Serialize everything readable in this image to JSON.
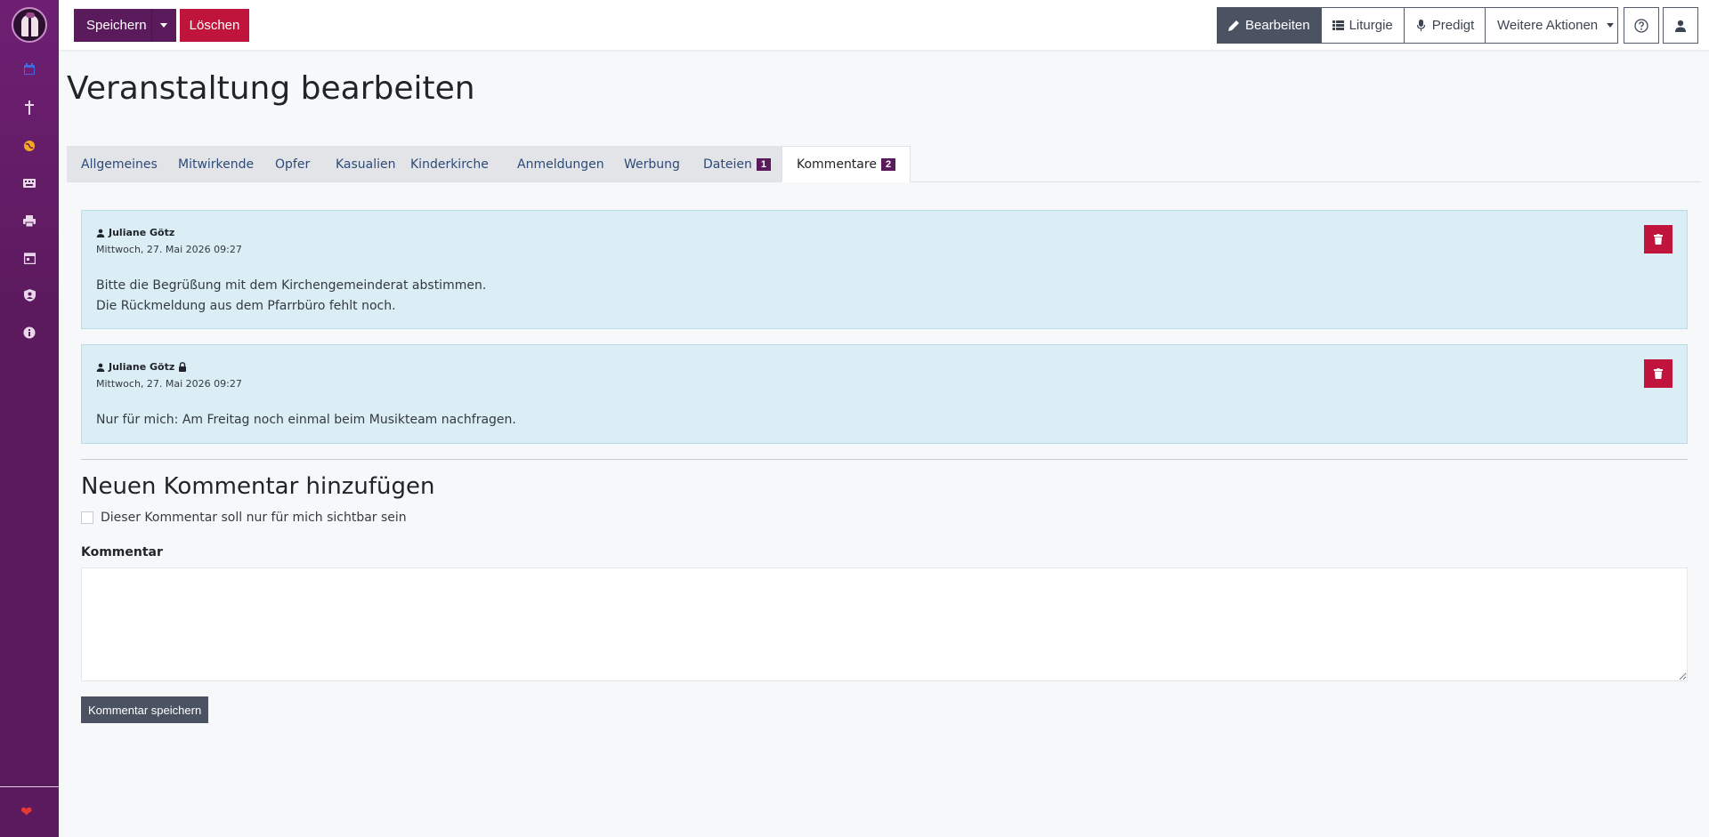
{
  "toolbar": {
    "save_label": "Speichern",
    "delete_label": "Löschen",
    "edit_label": "Bearbeiten",
    "liturgy_label": "Liturgie",
    "sermon_label": "Predigt",
    "more_label": "Weitere Aktionen"
  },
  "page": {
    "title": "Veranstaltung bearbeiten"
  },
  "tabs": [
    {
      "label": "Allgemeines"
    },
    {
      "label": "Mitwirkende"
    },
    {
      "label": "Opfer"
    },
    {
      "label": "Kasualien"
    },
    {
      "label": "Kinderkirche"
    },
    {
      "label": "Anmeldungen"
    },
    {
      "label": "Werbung"
    },
    {
      "label": "Dateien",
      "badge": "1"
    },
    {
      "label": "Kommentare",
      "badge": "2"
    }
  ],
  "comments": [
    {
      "author": "Juliane Götz",
      "date": "Mittwoch, 27. Mai 2026 09:27",
      "lines": [
        "Bitte die Begrüßung mit dem Kirchengemeinderat abstimmen.",
        "Die Rückmeldung aus dem Pfarrbüro fehlt noch."
      ]
    },
    {
      "author": "Juliane Götz",
      "date": "Mittwoch, 27. Mai 2026 09:27",
      "private": true,
      "lines": [
        "Nur für mich: Am Freitag noch einmal beim Musikteam nachfragen."
      ]
    }
  ],
  "new_comment": {
    "title": "Neuen Kommentar hinzufügen",
    "private_label": "Dieser Kommentar soll nur für mich sichtbar sein",
    "field_label": "Kommentar",
    "value": "",
    "submit_label": "Kommentar speichern"
  },
  "colors": {
    "sidebar": "#5a1a5c",
    "primary": "#5a1a5c",
    "danger": "#c0143c",
    "comment_bg": "#dbedf5",
    "dark_button": "#4b5261"
  },
  "icons": {
    "sidebar": [
      "calendar-icon",
      "cross-icon",
      "globe-icon",
      "keyboard-icon",
      "print-icon",
      "calendar-day-icon",
      "user-shield-icon",
      "info-icon",
      "heart-icon"
    ]
  }
}
